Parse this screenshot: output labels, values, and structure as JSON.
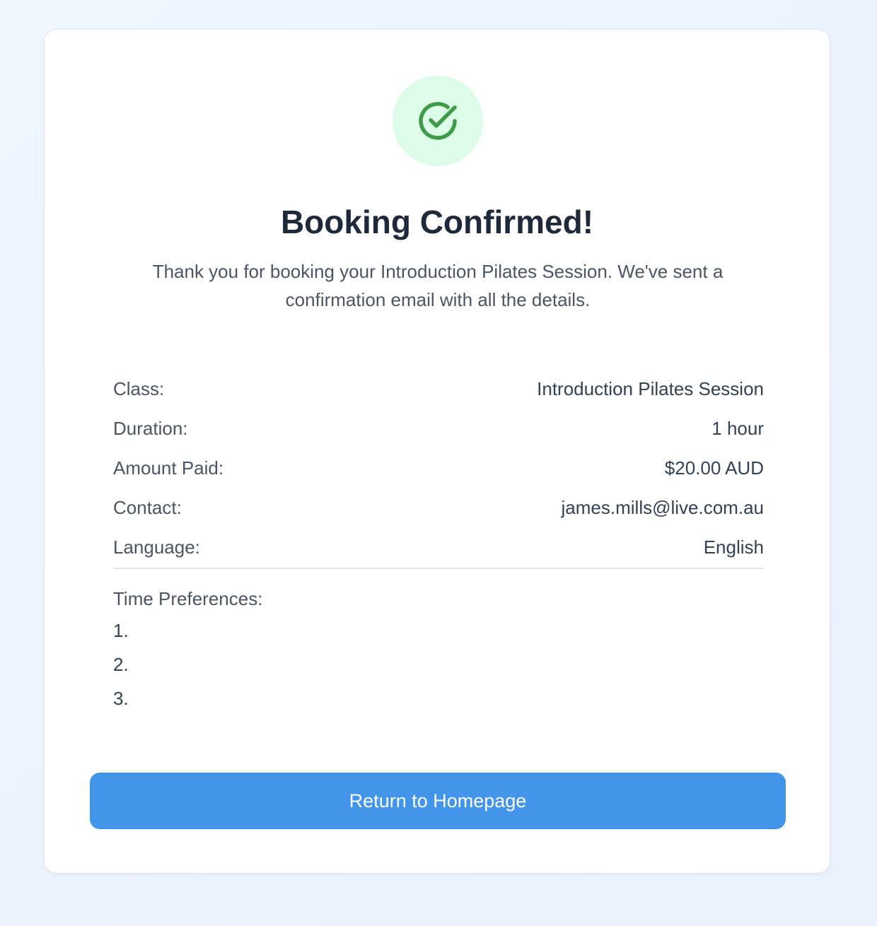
{
  "confirmation": {
    "icon": "check-circle-icon",
    "title": "Booking Confirmed!",
    "message": "Thank you for booking your Introduction Pilates Session. We've sent a confirmation email with all the details."
  },
  "details": [
    {
      "label": "Class:",
      "value": "Introduction Pilates Session"
    },
    {
      "label": "Duration:",
      "value": "1 hour"
    },
    {
      "label": "Amount Paid:",
      "value": "$20.00 AUD"
    },
    {
      "label": "Contact:",
      "value": "james.mills@live.com.au"
    },
    {
      "label": "Language:",
      "value": "English"
    }
  ],
  "time_preferences": {
    "label": "Time Preferences:",
    "items": [
      "1.",
      "2.",
      "3."
    ]
  },
  "actions": {
    "return_label": "Return to Homepage"
  },
  "colors": {
    "accent": "#4394eb",
    "success": "#3f9a4a",
    "success_bg": "#dcfce7"
  }
}
